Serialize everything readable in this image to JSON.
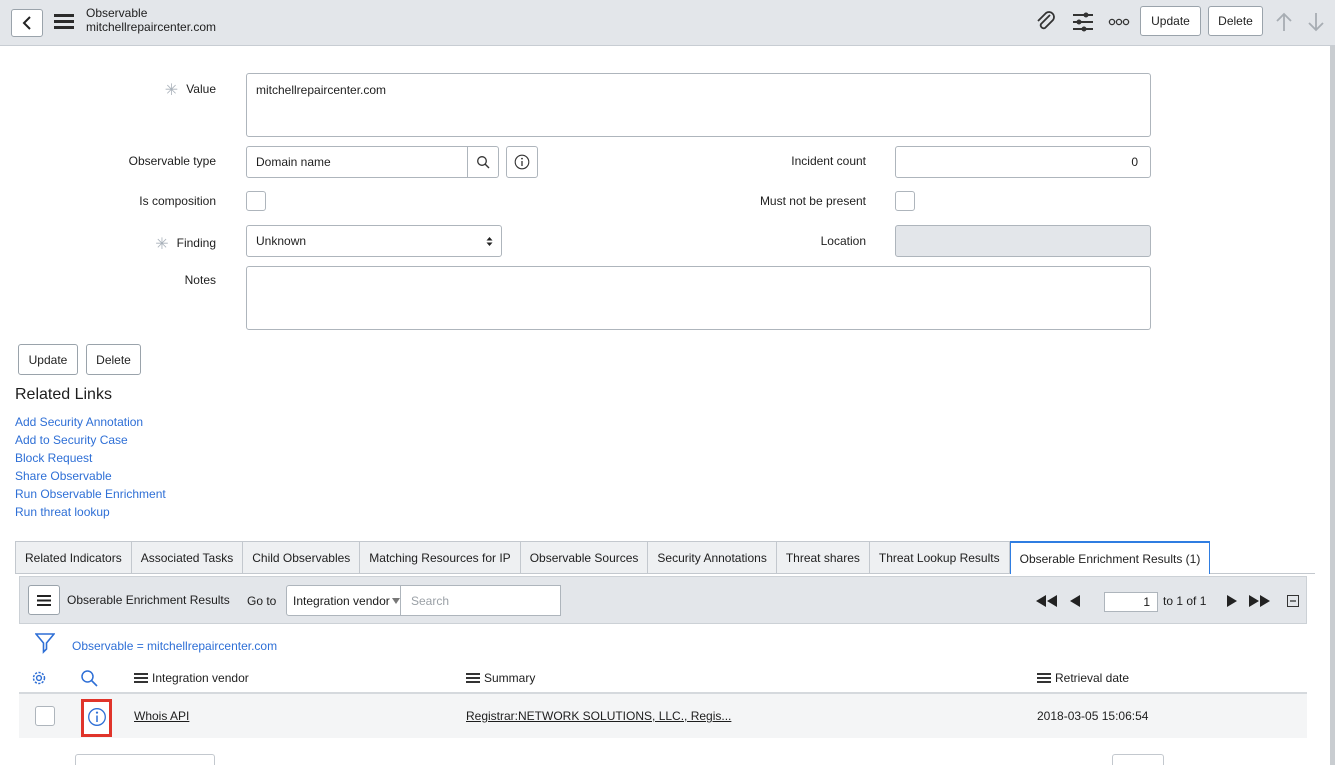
{
  "header": {
    "type_label": "Observable",
    "record_name": "mitchellrepaircenter.com",
    "update_label": "Update",
    "delete_label": "Delete"
  },
  "form": {
    "value": {
      "label": "Value",
      "value": "mitchellrepaircenter.com"
    },
    "observable_type": {
      "label": "Observable type",
      "value": "Domain name"
    },
    "incident_count": {
      "label": "Incident count",
      "value": "0"
    },
    "is_composition": {
      "label": "Is composition",
      "checked": false
    },
    "must_not_be_present": {
      "label": "Must not be present",
      "checked": false
    },
    "finding": {
      "label": "Finding",
      "value": "Unknown"
    },
    "location": {
      "label": "Location",
      "value": ""
    },
    "notes": {
      "label": "Notes",
      "value": ""
    },
    "update_label": "Update",
    "delete_label": "Delete"
  },
  "related_links": {
    "title": "Related Links",
    "items": [
      "Add Security Annotation",
      "Add to Security Case",
      "Block Request",
      "Share Observable",
      "Run Observable Enrichment",
      "Run threat lookup"
    ]
  },
  "tabs": [
    "Related Indicators",
    "Associated Tasks",
    "Child Observables",
    "Matching Resources for IP",
    "Observable Sources",
    "Security Annotations",
    "Threat shares",
    "Threat Lookup Results",
    "Obserable Enrichment Results (1)"
  ],
  "active_tab_index": 8,
  "list": {
    "title": "Obserable Enrichment Results",
    "goto_label": "Go to",
    "goto_field": "Integration vendor",
    "search_placeholder": "Search",
    "page_value": "1",
    "page_of": "to 1 of 1",
    "filter": "Observable = mitchellrepaircenter.com",
    "columns": [
      "Integration vendor",
      "Summary",
      "Retrieval date"
    ],
    "rows": [
      {
        "vendor": "Whois API",
        "summary": "Registrar:NETWORK SOLUTIONS, LLC., Regis...",
        "retrieval_date": "2018-03-05 15:06:54"
      }
    ]
  },
  "colors": {
    "link": "#2e6fd6",
    "active_tab": "#2f7de1",
    "highlight": "#e0342a"
  }
}
